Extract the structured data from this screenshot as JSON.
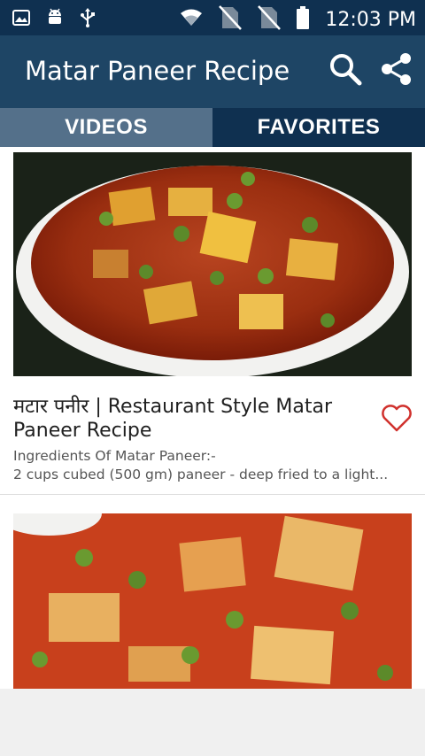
{
  "status": {
    "time": "12:03 PM"
  },
  "app": {
    "title": "Matar Paneer Recipe"
  },
  "tabs": [
    {
      "label": "VIDEOS"
    },
    {
      "label": "FAVORITES"
    }
  ],
  "videos": [
    {
      "title": "मटार पनीर | Restaurant Style Matar Paneer Recipe",
      "desc_line1": "Ingredients Of Matar Paneer:-",
      "desc_line2": "2 cups cubed (500 gm) paneer - deep fried to a light..."
    }
  ],
  "colors": {
    "status_bar": "#0f3050",
    "app_bar": "#1e4565",
    "tab_selected": "#54708a",
    "heart": "#d0312d"
  },
  "icons": [
    "image-icon",
    "android-icon",
    "usb-icon",
    "wifi-icon",
    "no-sim-icon",
    "battery-icon",
    "search-icon",
    "share-icon",
    "heart-outline-icon"
  ]
}
